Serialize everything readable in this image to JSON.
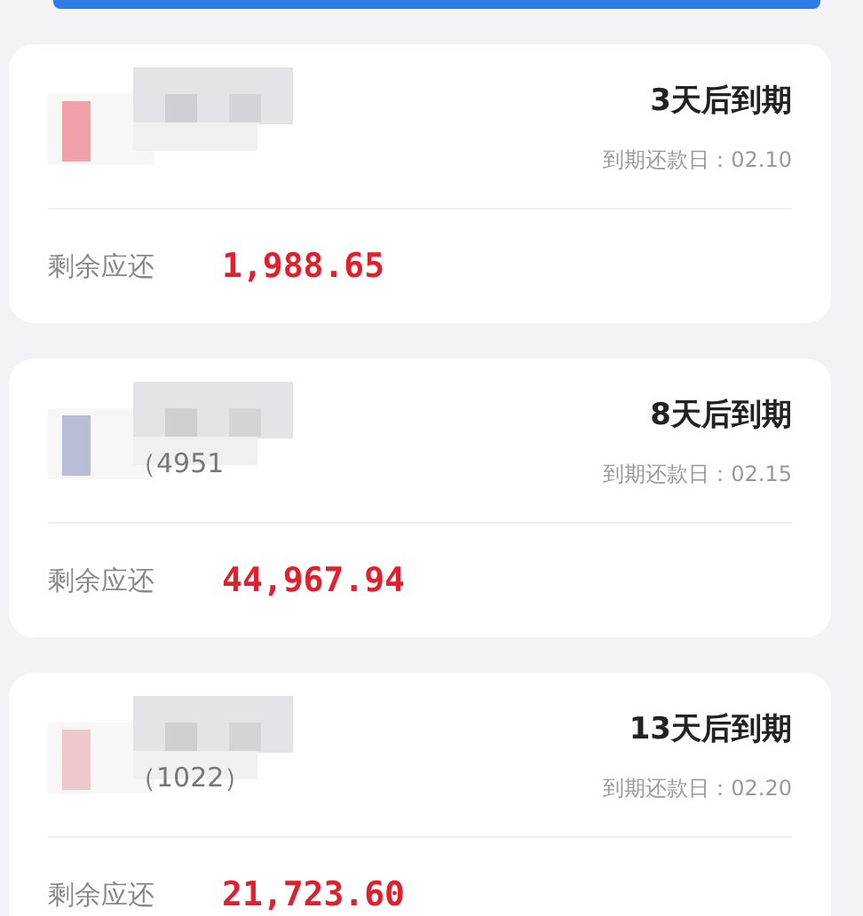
{
  "cards": [
    {
      "color": "#f0a0a8",
      "due_in": "3天后到期",
      "due_date": "到期还款日：02.10",
      "remaining_label": "剩余应还",
      "remaining_amount": "1,988.65"
    },
    {
      "color": "#b8bcd4",
      "card_suffix": "（4951",
      "due_in": "8天后到期",
      "due_date": "到期还款日：02.15",
      "remaining_label": "剩余应还",
      "remaining_amount": "44,967.94"
    },
    {
      "color": "#ecc8cc",
      "card_suffix": "（1022）",
      "due_in": "13天后到期",
      "due_date": "到期还款日：02.20",
      "remaining_label": "剩余应还",
      "remaining_amount": "21,723.60"
    }
  ]
}
